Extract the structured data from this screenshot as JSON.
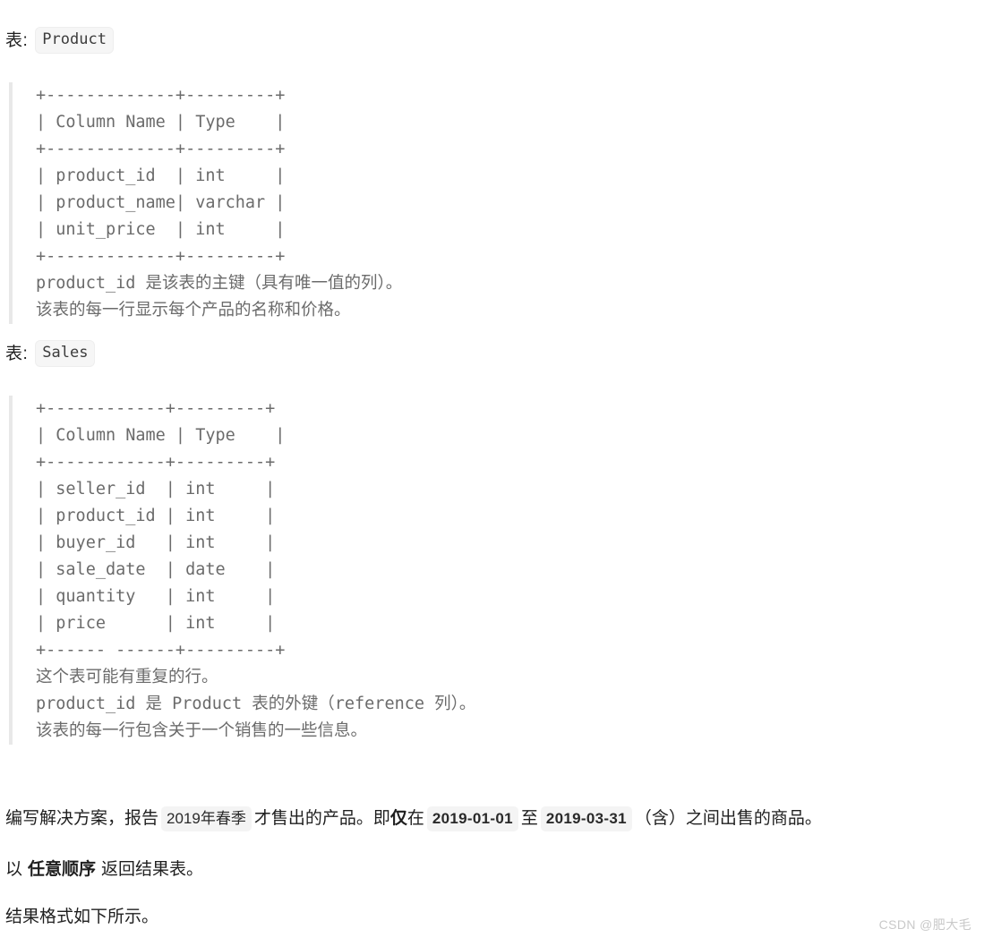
{
  "product_section": {
    "caption_label": "表:",
    "caption_code": "Product",
    "schema": "+-------------+---------+\n| Column Name | Type    |\n+-------------+---------+\n| product_id  | int     |\n| product_name| varchar |\n| unit_price  | int     |\n+-------------+---------+",
    "notes": "product_id 是该表的主键（具有唯一值的列）。\n该表的每一行显示每个产品的名称和价格。",
    "columns": [
      {
        "name": "product_id",
        "type": "int"
      },
      {
        "name": "product_name",
        "type": "varchar"
      },
      {
        "name": "unit_price",
        "type": "int"
      }
    ],
    "header": {
      "name": "Column Name",
      "type": "Type"
    }
  },
  "sales_section": {
    "caption_label": "表:",
    "caption_code": "Sales",
    "schema": "+------------+---------+\n| Column Name | Type    |\n+------------+---------+\n| seller_id  | int     |\n| product_id | int     |\n| buyer_id   | int     |\n| sale_date  | date    |\n| quantity   | int     |\n| price      | int     |\n+------ ------+---------+",
    "notes": "这个表可能有重复的行。\nproduct_id 是 Product 表的外键（reference 列）。\n该表的每一行包含关于一个销售的一些信息。",
    "columns": [
      {
        "name": "seller_id",
        "type": "int"
      },
      {
        "name": "product_id",
        "type": "int"
      },
      {
        "name": "buyer_id",
        "type": "int"
      },
      {
        "name": "sale_date",
        "type": "date"
      },
      {
        "name": "quantity",
        "type": "int"
      },
      {
        "name": "price",
        "type": "int"
      }
    ],
    "header": {
      "name": "Column Name",
      "type": "Type"
    }
  },
  "question": {
    "line1_part1": "编写解决方案，报告",
    "line1_badge1": "2019年春季",
    "line1_part2": "才售出的产品。即",
    "line1_bold": "仅",
    "line1_part3": "在",
    "line1_badge2": "2019-01-01",
    "line1_part4": "至",
    "line1_badge3": "2019-03-31",
    "line1_part5": "（含）之间出售的商品。",
    "line2_part1": "以",
    "line2_bold": "任意顺序",
    "line2_part2": "返回结果表。",
    "line3": "结果格式如下所示。"
  },
  "watermark": "CSDN @肥大毛"
}
